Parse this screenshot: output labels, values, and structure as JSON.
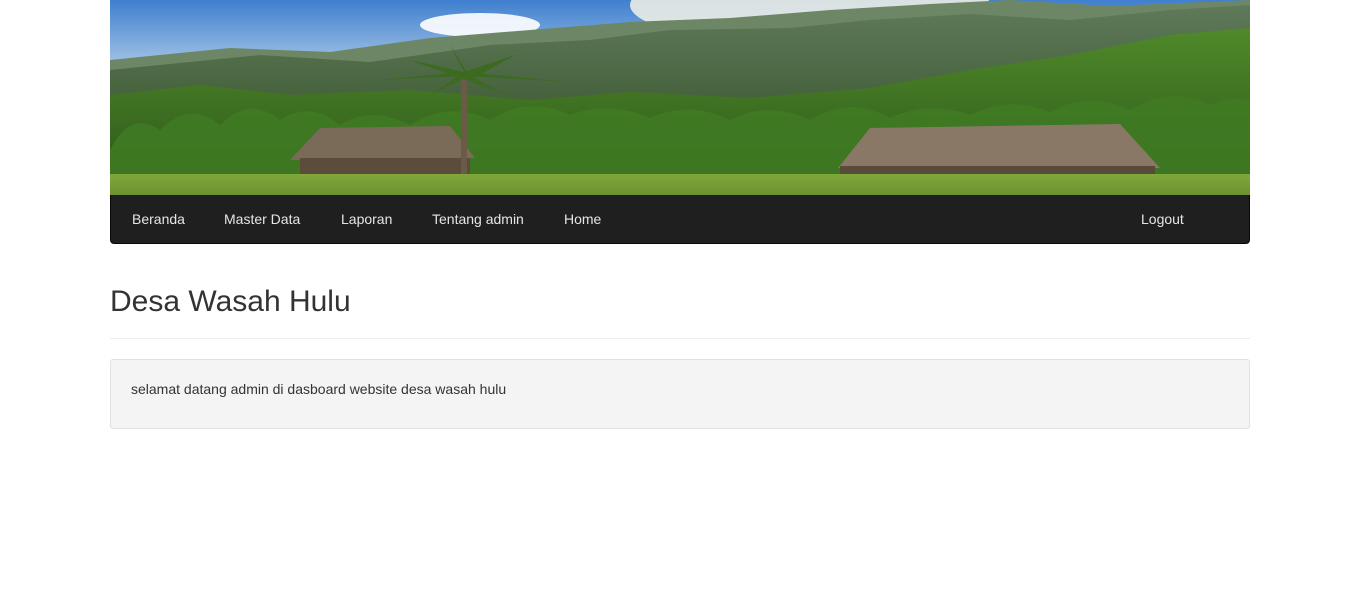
{
  "banner": {
    "image": "mountain-village-landscape"
  },
  "navbar": {
    "items": [
      {
        "label": "Beranda"
      },
      {
        "label": "Master Data"
      },
      {
        "label": "Laporan"
      },
      {
        "label": "Tentang admin"
      },
      {
        "label": "Home"
      }
    ],
    "logout_label": "Logout"
  },
  "main": {
    "title": "Desa Wasah Hulu",
    "welcome_text": "selamat datang admin di dasboard website desa wasah hulu"
  },
  "colors": {
    "navbar_bg": "#1f1f1f",
    "nav_text": "#e6e6e6",
    "well_bg": "#f4f4f4"
  }
}
